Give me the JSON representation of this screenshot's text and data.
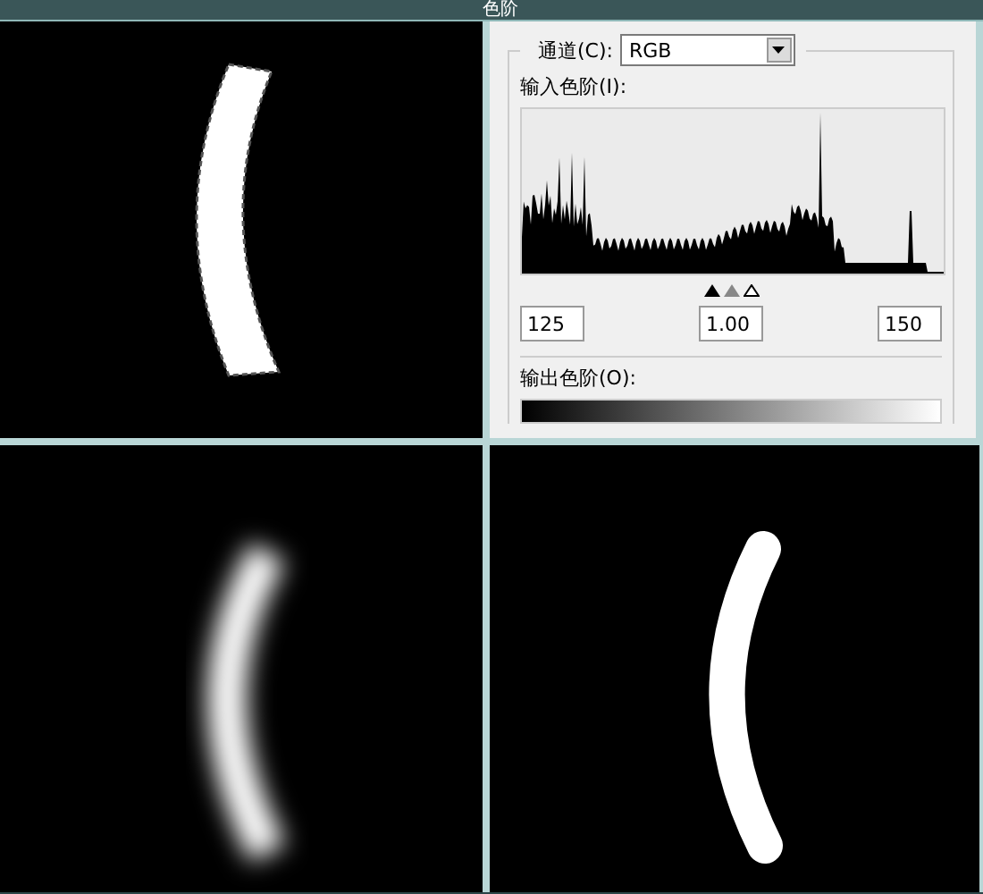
{
  "window": {
    "title": "色阶"
  },
  "levels_dialog": {
    "channel_label": "通道(C):",
    "channel_value": "RGB",
    "input_levels_label": "输入色阶(I):",
    "input_values": [
      "125",
      "1.00",
      "150"
    ],
    "output_levels_label": "输出色阶(O):"
  }
}
